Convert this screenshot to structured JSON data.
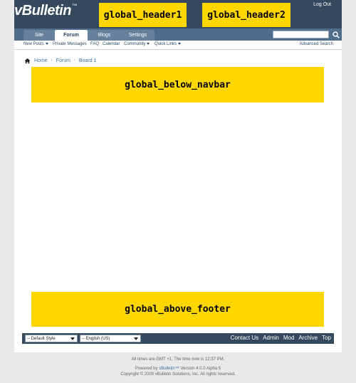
{
  "header": {
    "logo_text": "vBulletin",
    "logo_tm": "™",
    "block1": "global_header1",
    "block2": "global_header2",
    "logout": "Log Out"
  },
  "navbar": {
    "tabs": [
      {
        "label": "Site"
      },
      {
        "label": "Forum"
      },
      {
        "label": "Blogs"
      },
      {
        "label": "Settings"
      }
    ],
    "search_value": ""
  },
  "subnav": {
    "items": [
      {
        "label": "New Posts"
      },
      {
        "label": "Private Messages"
      },
      {
        "label": "FAQ"
      },
      {
        "label": "Calendar"
      },
      {
        "label": "Community"
      },
      {
        "label": "Quick Links"
      }
    ],
    "advanced_search": "Advanced Search"
  },
  "breadcrumb": {
    "items": [
      "Home",
      "Forum",
      "Board 1"
    ],
    "separator": "›"
  },
  "content": {
    "below_navbar": "global_below_navbar",
    "above_footer": "global_above_footer"
  },
  "footer": {
    "style_select": "-- Default Style",
    "language_select": "-- English (US)",
    "links": [
      "Contact Us",
      "Admin",
      "Mod",
      "Archive",
      "Top"
    ]
  },
  "bottom": {
    "time_prefix": "All times are GMT +1. The time now is",
    "time_value": "12:37 PM",
    "powered_prefix": "Powered by",
    "powered_link": "vBulletin™",
    "powered_suffix": "Version 4.0.0 Alpha 5",
    "copyright": "Copyright © 2009 vBulletin Solutions, Inc. All rights reserved."
  },
  "colors": {
    "header_bg": "#34495e",
    "placeholder_yellow": "#ffd700",
    "link_blue": "#3e6ea0"
  }
}
